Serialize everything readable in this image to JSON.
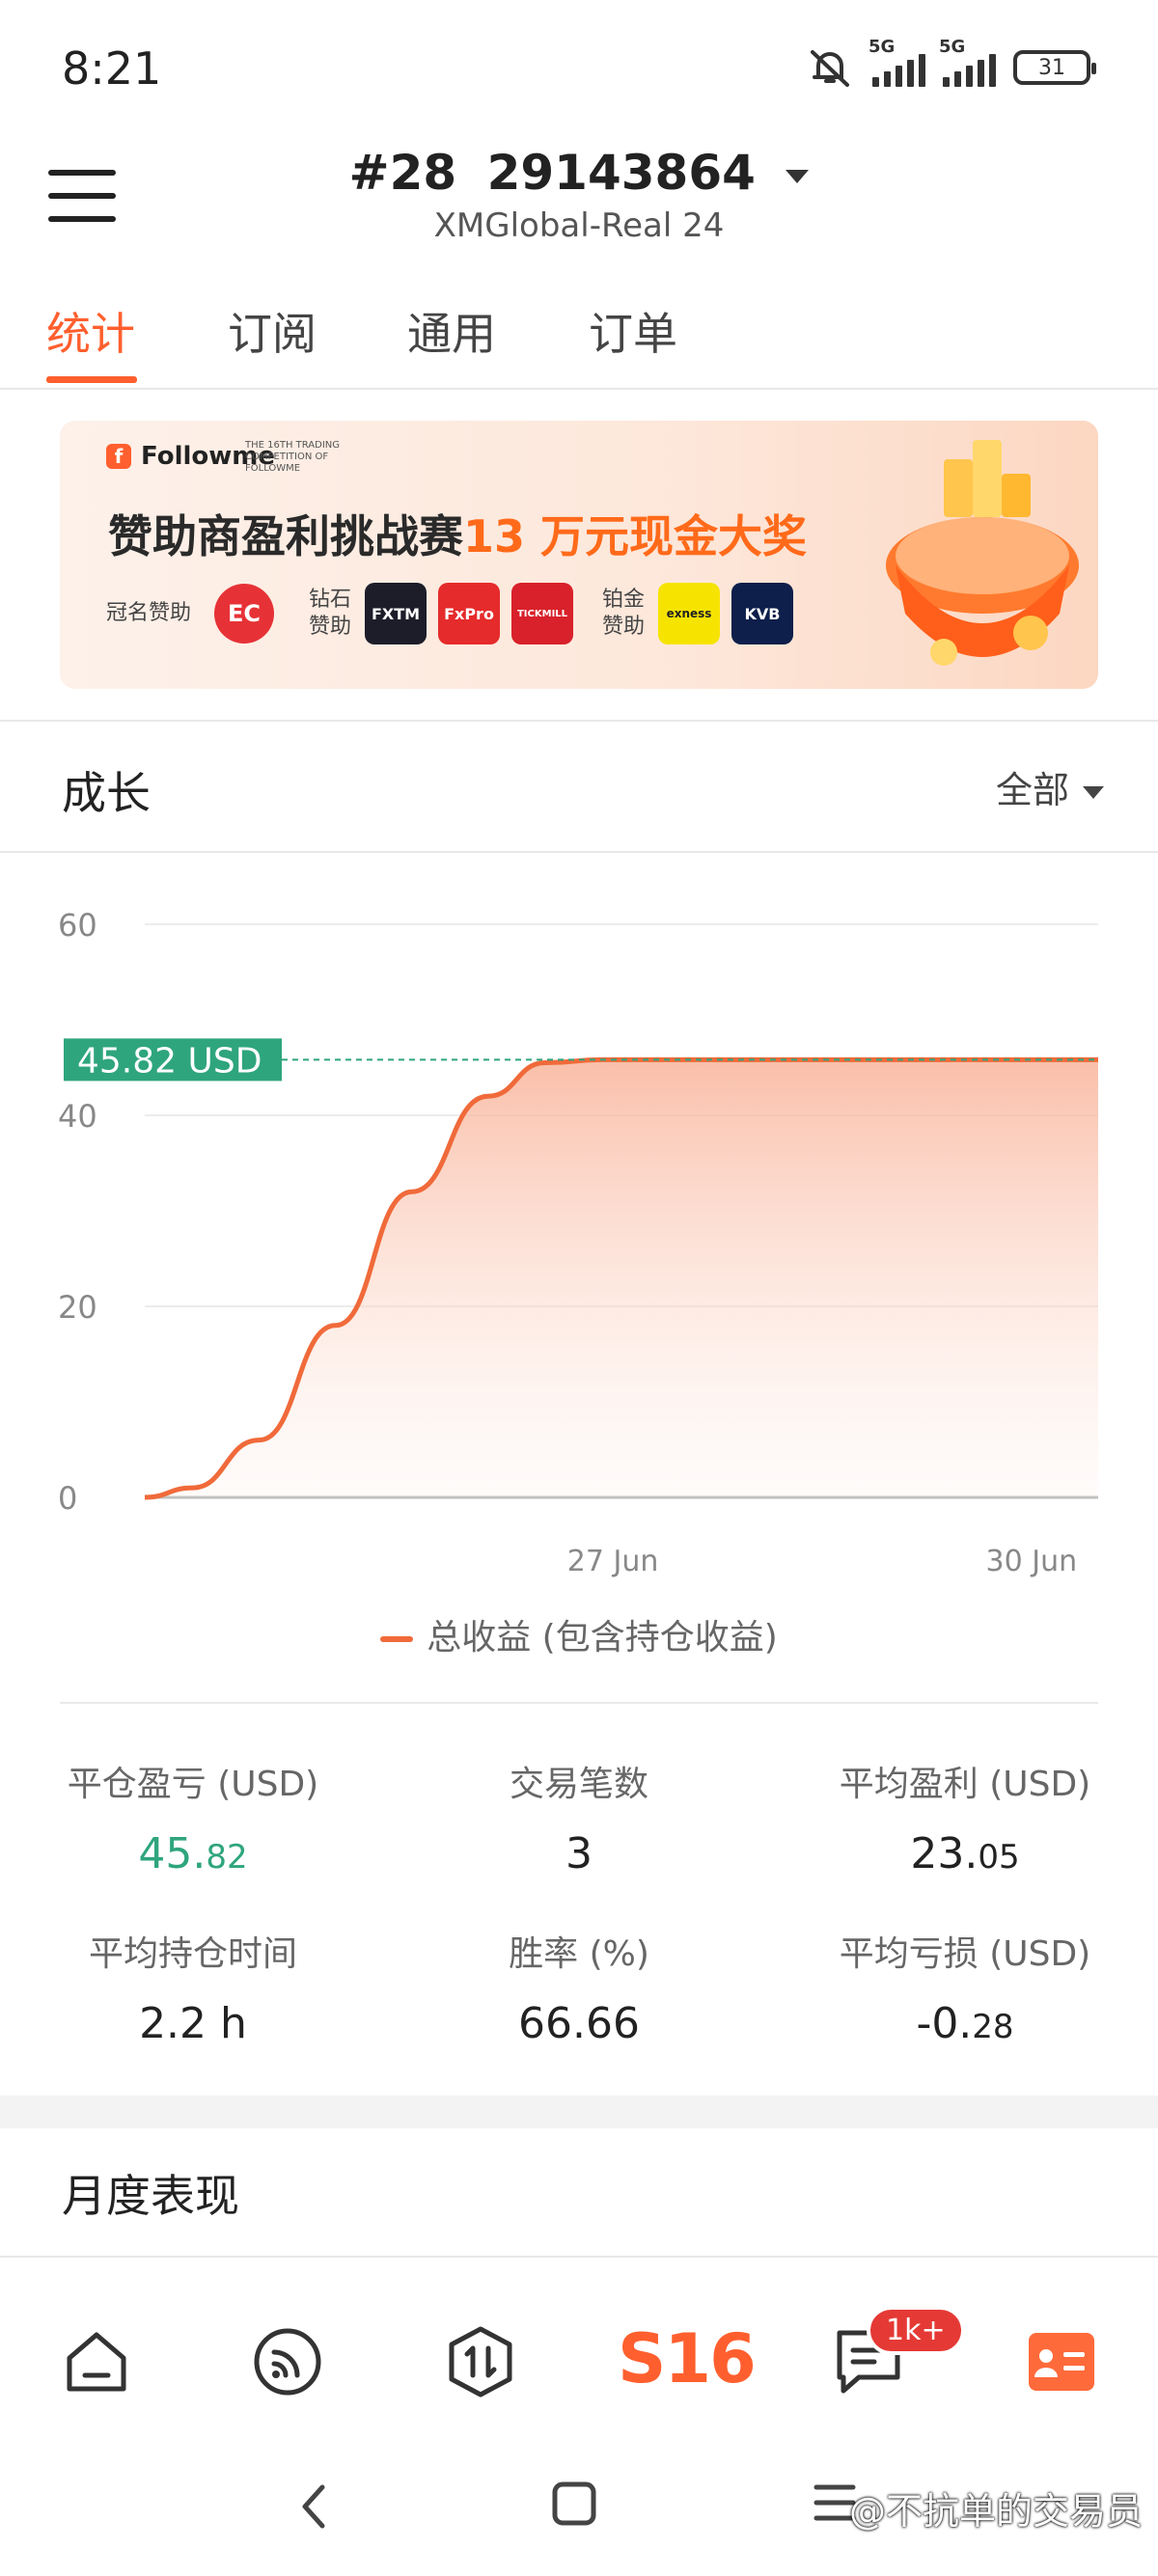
{
  "status_bar": {
    "time": "8:21",
    "signal1_label": "5G",
    "signal2_label": "5G",
    "battery": "31"
  },
  "header": {
    "rank": "#28",
    "account_id": "29143864",
    "server": "XMGlobal-Real 24"
  },
  "tabs": [
    {
      "label": "统计",
      "active": true
    },
    {
      "label": "订阅",
      "active": false
    },
    {
      "label": "通用",
      "active": false
    },
    {
      "label": "订单",
      "active": false
    }
  ],
  "banner": {
    "brand": "Followme",
    "comp_text": "THE 16TH TRADING COMPETITION OF FOLLOWME",
    "headline_prefix": "赞助商盈利挑战赛",
    "headline_highlight": "13 万元现金大奖",
    "title_sponsor_label": "冠名赞助",
    "title_sponsor": "EC",
    "diamond_label": "钻石赞助",
    "diamond_sponsors": [
      "FXTM",
      "FxPro",
      "TICKMILL"
    ],
    "platinum_label": "铂金赞助",
    "platinum_sponsors": [
      "exness",
      "KVB"
    ]
  },
  "growth": {
    "title": "成长",
    "filter": "全部"
  },
  "chart_data": {
    "type": "area",
    "y_ticks": [
      "60",
      "40",
      "20",
      "0"
    ],
    "ylim": [
      0,
      60
    ],
    "x_ticks": [
      "27 Jun",
      "30 Jun"
    ],
    "series": [
      {
        "name": "总收益 (包含持仓收益)",
        "x": [
          0,
          0.05,
          0.12,
          0.2,
          0.28,
          0.36,
          0.42,
          0.48,
          1.0
        ],
        "values": [
          0,
          1,
          6,
          18,
          32,
          42,
          45.5,
          45.82,
          45.82
        ]
      }
    ],
    "current_value_label": "45.82 USD",
    "current_value": 45.82,
    "colors": {
      "line": "#f06a3a",
      "marker": "#2ea57d"
    }
  },
  "stats": [
    {
      "label": "平仓盈亏 (USD)",
      "int": "45.",
      "dec": "82",
      "positive": true
    },
    {
      "label": "交易笔数",
      "int": "3",
      "dec": "",
      "positive": false
    },
    {
      "label": "平均盈利 (USD)",
      "int": "23.",
      "dec": "05",
      "positive": false
    },
    {
      "label": "平均持仓时间",
      "int": "2.2 h",
      "dec": "",
      "positive": false
    },
    {
      "label": "胜率 (%)",
      "int": "66.66",
      "dec": "",
      "positive": false
    },
    {
      "label": "平均亏损 (USD)",
      "int": "-0.",
      "dec": "28",
      "positive": false
    }
  ],
  "monthly": {
    "title": "月度表现"
  },
  "bottom_nav": {
    "s16": "S16",
    "badge": "1k+",
    "icons": [
      "home-icon",
      "feed-icon",
      "trade-icon",
      "s16-icon",
      "messages-icon",
      "profile-card-icon"
    ]
  },
  "watermark": "@不抗单的交易员"
}
